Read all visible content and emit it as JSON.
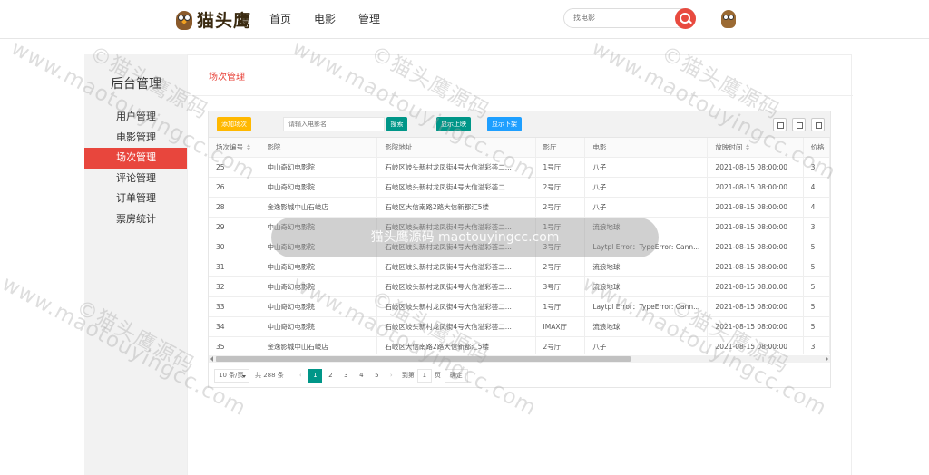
{
  "header": {
    "logo_text": "猫头鹰",
    "nav": [
      "首页",
      "电影",
      "管理"
    ],
    "search_placeholder": "找电影"
  },
  "sidebar": {
    "title": "后台管理",
    "items": [
      "用户管理",
      "电影管理",
      "场次管理",
      "评论管理",
      "订单管理",
      "票房统计"
    ],
    "active_index": 2
  },
  "main": {
    "title": "场次管理"
  },
  "toolbar": {
    "add_label": "添加场次",
    "search_placeholder": "请输入电影名",
    "search_label": "搜索",
    "show_on_label": "显示上映",
    "show_off_label": "显示下架"
  },
  "table": {
    "headers": [
      "场次编号",
      "影院",
      "影院地址",
      "影厅",
      "电影",
      "放映时间",
      "价格"
    ],
    "rows": [
      [
        "25",
        "中山奇幻电影院",
        "石岐区岐头新村龙凤街4号大信溢彩荟二...",
        "1号厅",
        "八子",
        "2021-08-15 08:00:00",
        "3"
      ],
      [
        "26",
        "中山奇幻电影院",
        "石岐区岐头新村龙凤街4号大信溢彩荟二...",
        "2号厅",
        "八子",
        "2021-08-15 08:00:00",
        "4"
      ],
      [
        "28",
        "金逸影城中山石岐店",
        "石岐区大信南路2路大信新都汇5楼",
        "2号厅",
        "八子",
        "2021-08-15 08:00:00",
        "4"
      ],
      [
        "29",
        "中山奇幻电影院",
        "石岐区岐头新村龙凤街4号大信溢彩荟二...",
        "1号厅",
        "流浪地球",
        "2021-08-15 08:00:00",
        "3"
      ],
      [
        "30",
        "中山奇幻电影院",
        "石岐区岐头新村龙凤街4号大信溢彩荟二...",
        "3号厅",
        "Laytpl Error：TypeError: Cann...",
        "2021-08-15 08:00:00",
        "5"
      ],
      [
        "31",
        "中山奇幻电影院",
        "石岐区岐头新村龙凤街4号大信溢彩荟二...",
        "2号厅",
        "流浪地球",
        "2021-08-15 08:00:00",
        "5"
      ],
      [
        "32",
        "中山奇幻电影院",
        "石岐区岐头新村龙凤街4号大信溢彩荟二...",
        "3号厅",
        "流浪地球",
        "2021-08-15 08:00:00",
        "5"
      ],
      [
        "33",
        "中山奇幻电影院",
        "石岐区岐头新村龙凤街4号大信溢彩荟二...",
        "1号厅",
        "Laytpl Error：TypeError: Cann...",
        "2021-08-15 08:00:00",
        "5"
      ],
      [
        "34",
        "中山奇幻电影院",
        "石岐区岐头新村龙凤街4号大信溢彩荟二...",
        "IMAX厅",
        "流浪地球",
        "2021-08-15 08:00:00",
        "5"
      ],
      [
        "35",
        "金逸影城中山石岐店",
        "石岐区大信南路2路大信新都汇5楼",
        "2号厅",
        "八子",
        "2021-08-15 08:00:00",
        "3"
      ]
    ]
  },
  "pager": {
    "limit": "10 条/页",
    "count": "共 288 条",
    "pages": [
      "1",
      "2",
      "3",
      "4",
      "5"
    ],
    "current": "1",
    "goto_label": "到第",
    "goto_value": "1",
    "page_unit": "页",
    "confirm": "确定"
  },
  "watermark": {
    "text": "©猫头鹰源码",
    "url": "www.maotouyingcc.com",
    "center": "猫头鹰源码 maotouyingcc.com"
  }
}
